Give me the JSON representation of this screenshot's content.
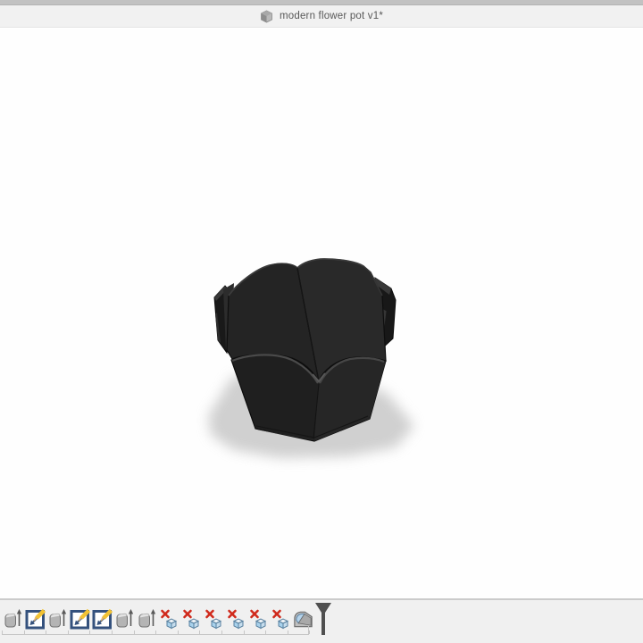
{
  "tab_bar": {
    "document_tab": {
      "title": "modern flower pot v1*",
      "icon": "cube-icon"
    }
  },
  "viewport": {
    "background": "#fefefe",
    "model": {
      "name": "modern flower pot",
      "body_color": "#242424",
      "edge_highlight_color": "#4a4a4a",
      "shadow_color": "#c8c8c8"
    }
  },
  "timeline": {
    "features": [
      {
        "type": "extrude",
        "label": "Extrude"
      },
      {
        "type": "sketch",
        "label": "Sketch"
      },
      {
        "type": "extrude",
        "label": "Extrude"
      },
      {
        "type": "sketch",
        "label": "Sketch"
      },
      {
        "type": "sketch",
        "label": "Sketch"
      },
      {
        "type": "extrude",
        "label": "Extrude"
      },
      {
        "type": "extrude",
        "label": "Extrude"
      },
      {
        "type": "error",
        "label": "Failed feature"
      },
      {
        "type": "error",
        "label": "Failed feature"
      },
      {
        "type": "error",
        "label": "Failed feature"
      },
      {
        "type": "error",
        "label": "Failed feature"
      },
      {
        "type": "error",
        "label": "Failed feature"
      },
      {
        "type": "error",
        "label": "Failed feature"
      },
      {
        "type": "fillet",
        "label": "Fillet"
      }
    ],
    "playhead": {
      "location": "end"
    },
    "icon_colors": {
      "sketch_border": "#34517d",
      "pencil_yellow": "#f2c233",
      "error_x_red": "#d02a1c",
      "cube_face_blue": "#a9d2ec",
      "extrude_gray": "#b4b4b4",
      "fillet_face_blue": "#b5d3ea"
    }
  },
  "chrome": {
    "top_strip_color": "#c2c2c2",
    "tab_bar_color": "#f1f1f1",
    "timeline_bar_color": "#f0f0f0"
  }
}
